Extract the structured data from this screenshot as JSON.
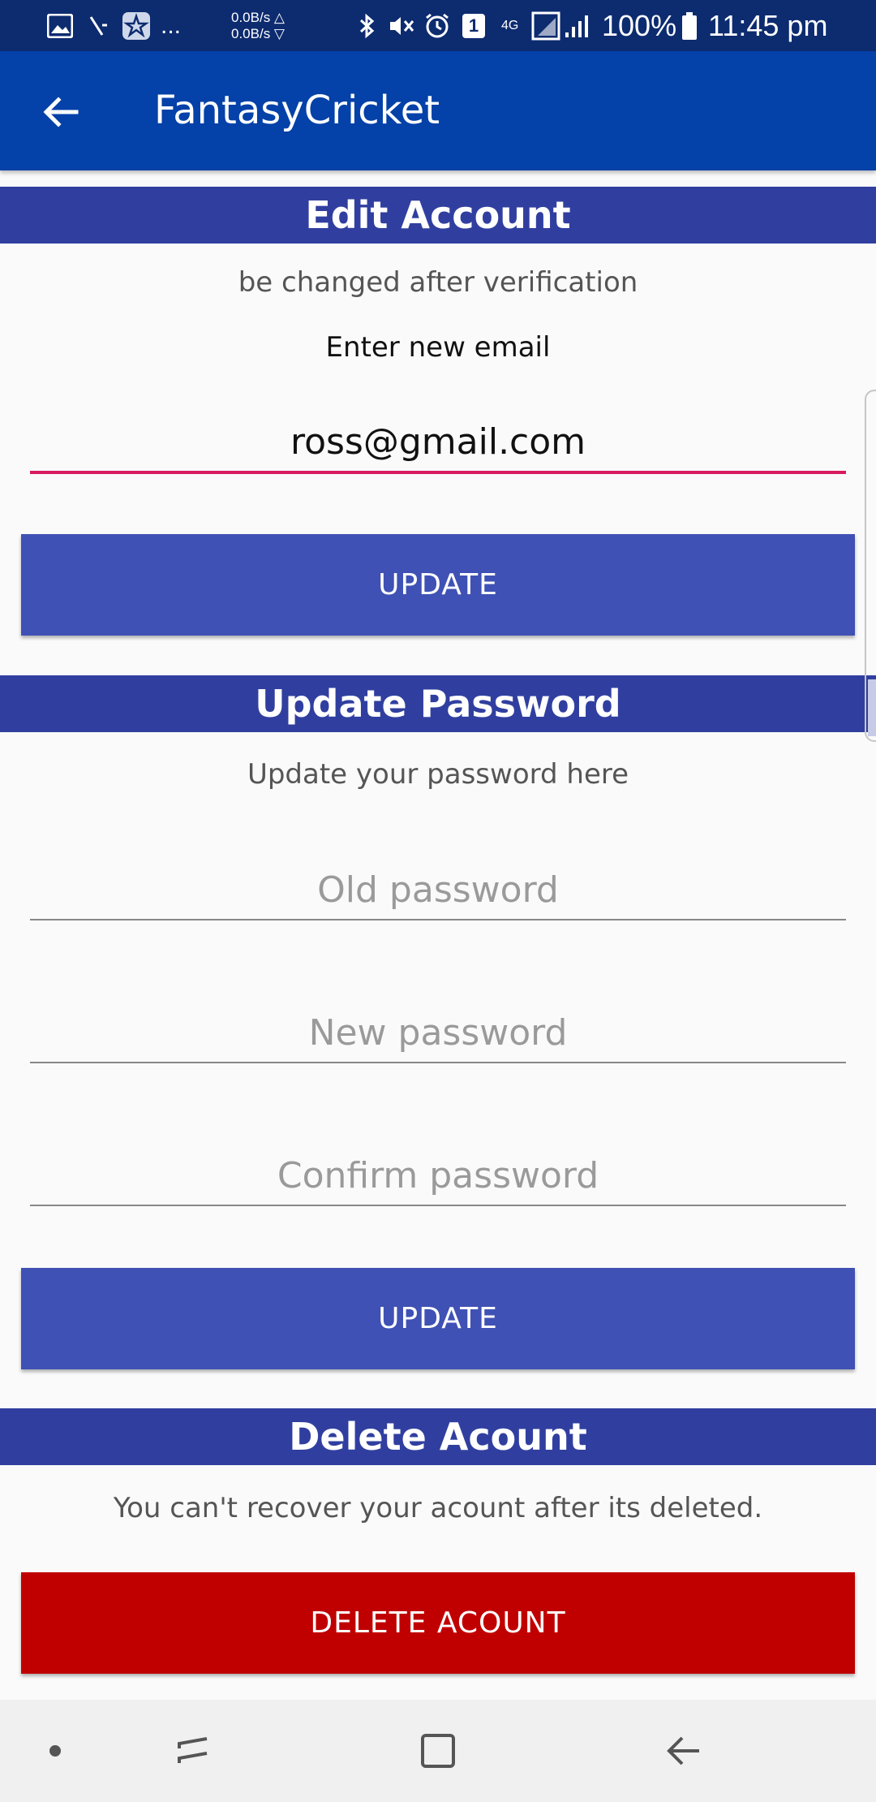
{
  "status_bar": {
    "net_up": "0.0B/s △",
    "net_down": "0.0B/s ▽",
    "notification_more": "...",
    "sim_badge": "1",
    "network": "4G",
    "battery": "100%",
    "time": "11:45 pm"
  },
  "app_bar": {
    "title": "FantasyCricket"
  },
  "edit_account": {
    "header": "Edit Account",
    "subtext": "be changed after verification",
    "label": "Enter new email",
    "email_value": "ross@gmail.com",
    "button": "UPDATE"
  },
  "update_password": {
    "header": "Update Password",
    "subtext": "Update your password here",
    "old_placeholder": "Old password",
    "new_placeholder": "New password",
    "confirm_placeholder": "Confirm password",
    "button": "UPDATE"
  },
  "delete_account": {
    "header": "Delete Acount",
    "subtext": "You can't recover your acount after its deleted.",
    "button": "DELETE ACOUNT"
  },
  "colors": {
    "status_bar": "#0d2b6f",
    "app_bar": "#0441a8",
    "section_header": "#303f9f",
    "button": "#3f51b5",
    "danger_button": "#c00000",
    "active_underline": "#d81b60"
  }
}
